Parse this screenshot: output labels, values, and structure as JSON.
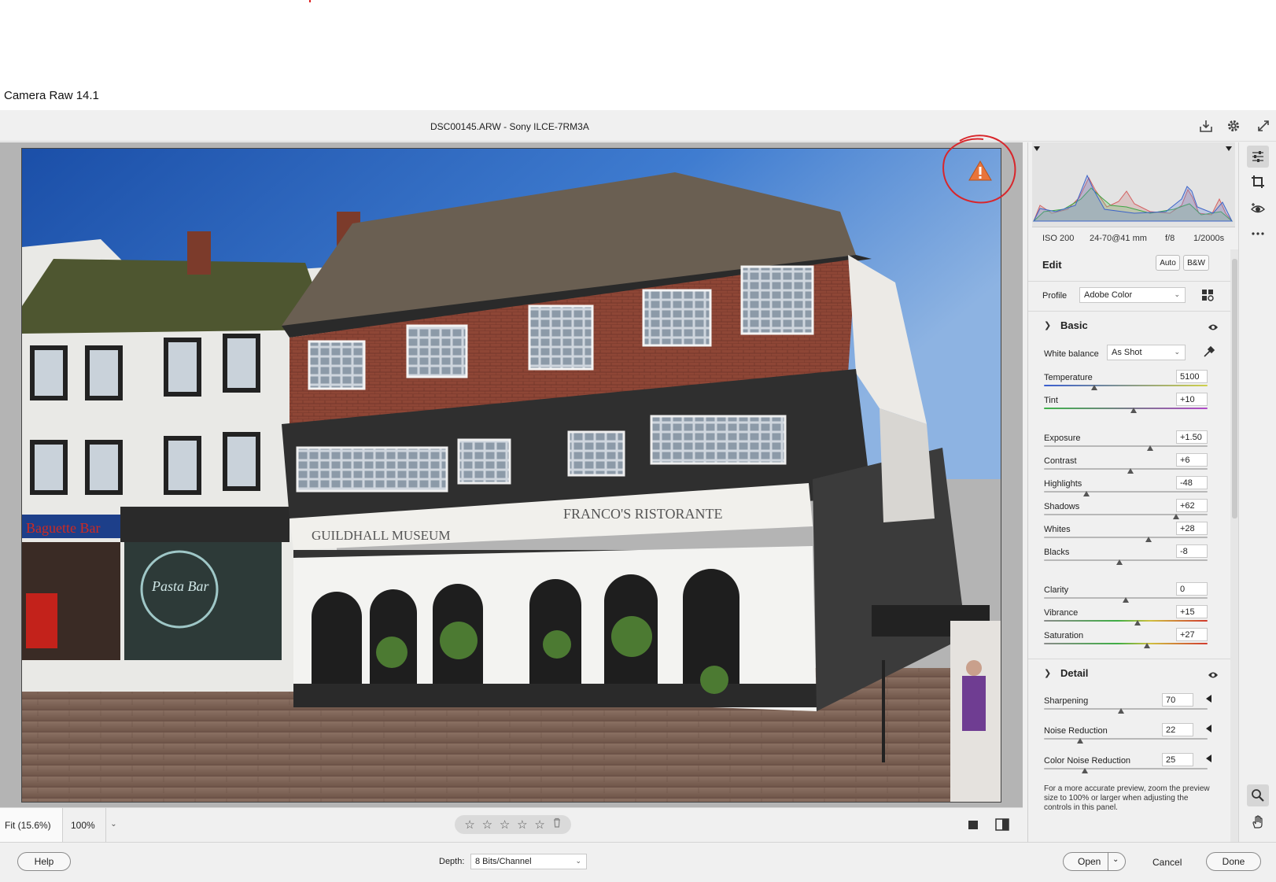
{
  "window": {
    "title": "Camera Raw 14.1"
  },
  "header": {
    "file_info": "DSC00145.ARW  -  Sony ILCE-7RM3A",
    "icons": [
      "save-image-icon",
      "settings-gear-icon",
      "fullscreen-icon"
    ]
  },
  "preview": {
    "warning_icon": "warning-triangle-icon",
    "annotation": "red-hand-drawn-circle",
    "signs": {
      "left": "GUILDHALL  MUSEUM",
      "right": "FRANCO'S  RISTORANTE"
    }
  },
  "preview_toolbar": {
    "zoom_fit": "Fit (15.6%)",
    "zoom_100": "100%",
    "rating_stars": 5,
    "rating": 0
  },
  "exif": {
    "iso": "ISO 200",
    "lens": "24-70@41 mm",
    "aperture": "f/8",
    "shutter": "1/2000s"
  },
  "edit": {
    "title": "Edit",
    "auto_label": "Auto",
    "bw_label": "B&W",
    "profile_label": "Profile",
    "profile_value": "Adobe Color"
  },
  "basic": {
    "title": "Basic",
    "wb_label": "White balance",
    "wb_value": "As Shot",
    "sliders": [
      {
        "label": "Temperature",
        "value": "5100",
        "pos": 0.31
      },
      {
        "label": "Tint",
        "value": "+10",
        "pos": 0.55
      },
      {
        "label": "Exposure",
        "value": "+1.50",
        "pos": 0.65
      },
      {
        "label": "Contrast",
        "value": "+6",
        "pos": 0.53
      },
      {
        "label": "Highlights",
        "value": "-48",
        "pos": 0.26
      },
      {
        "label": "Shadows",
        "value": "+62",
        "pos": 0.81
      },
      {
        "label": "Whites",
        "value": "+28",
        "pos": 0.64
      },
      {
        "label": "Blacks",
        "value": "-8",
        "pos": 0.46
      },
      {
        "label": "Clarity",
        "value": "0",
        "pos": 0.5
      },
      {
        "label": "Vibrance",
        "value": "+15",
        "pos": 0.57
      },
      {
        "label": "Saturation",
        "value": "+27",
        "pos": 0.63
      }
    ]
  },
  "detail": {
    "title": "Detail",
    "sliders": [
      {
        "label": "Sharpening",
        "value": "70",
        "pos": 0.47
      },
      {
        "label": "Noise Reduction",
        "value": "22",
        "pos": 0.22
      },
      {
        "label": "Color Noise Reduction",
        "value": "25",
        "pos": 0.25
      }
    ],
    "note": "For a more accurate preview, zoom the preview size to 100% or larger when adjusting the controls in this panel."
  },
  "footer": {
    "help_label": "Help",
    "depth_label": "Depth:",
    "depth_value": "8 Bits/Channel",
    "open_label": "Open",
    "cancel_label": "Cancel",
    "done_label": "Done"
  },
  "colors": {
    "accent_red": "#d8262b",
    "warning_orange": "#e8743a"
  }
}
